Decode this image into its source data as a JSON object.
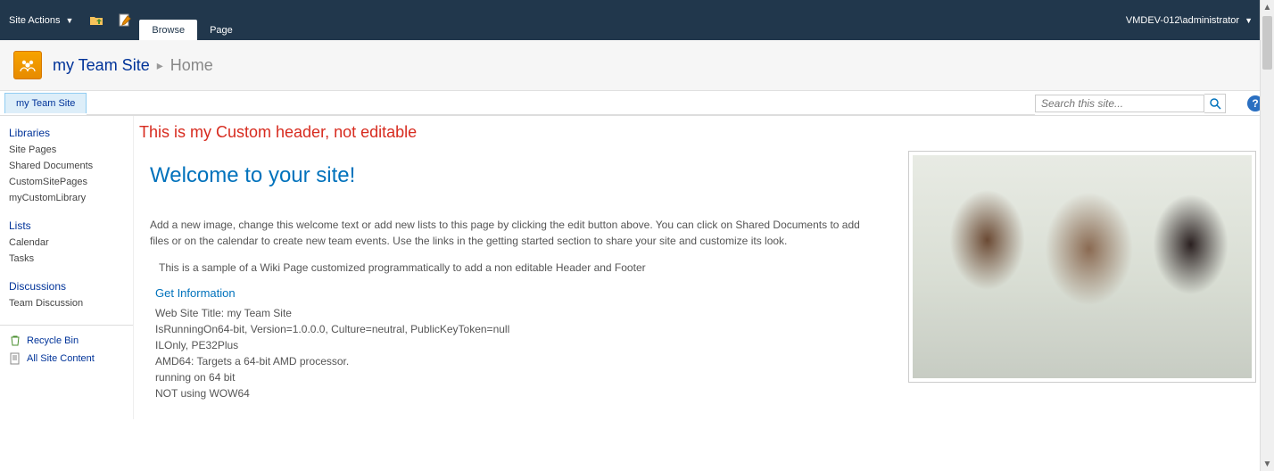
{
  "ribbon": {
    "site_actions_label": "Site Actions",
    "tabs": [
      {
        "label": "Browse",
        "active": true
      },
      {
        "label": "Page",
        "active": false
      }
    ],
    "user_label": "VMDEV-012\\administrator"
  },
  "title": {
    "site_name": "my Team Site",
    "page_name": "Home"
  },
  "topnav": {
    "tab_label": "my Team Site",
    "search_placeholder": "Search this site..."
  },
  "leftnav": {
    "sections": [
      {
        "heading": "Libraries",
        "items": [
          "Site Pages",
          "Shared Documents",
          "CustomSitePages",
          "myCustomLibrary"
        ]
      },
      {
        "heading": "Lists",
        "items": [
          "Calendar",
          "Tasks"
        ]
      },
      {
        "heading": "Discussions",
        "items": [
          "Team Discussion"
        ]
      }
    ],
    "recycle_bin": "Recycle Bin",
    "all_content": "All Site Content"
  },
  "main": {
    "custom_header": "This is my Custom header, not editable",
    "welcome_heading": "Welcome to your site!",
    "welcome_text": "Add a new image, change this welcome text or add new lists to this page by clicking the edit button above. You can click on Shared Documents to add files or on the calendar to create new team events. Use the links in the getting started section to share your site and customize its look.",
    "wiki_note": "This is a sample of a Wiki Page customized programmatically to add a non editable Header and Footer",
    "info_heading": "Get Information",
    "info_text": "Web Site Title: my Team Site\nIsRunningOn64-bit, Version=1.0.0.0, Culture=neutral, PublicKeyToken=null\nILOnly, PE32Plus\nAMD64: Targets a 64-bit AMD processor.\nrunning on 64 bit\nNOT using WOW64"
  }
}
